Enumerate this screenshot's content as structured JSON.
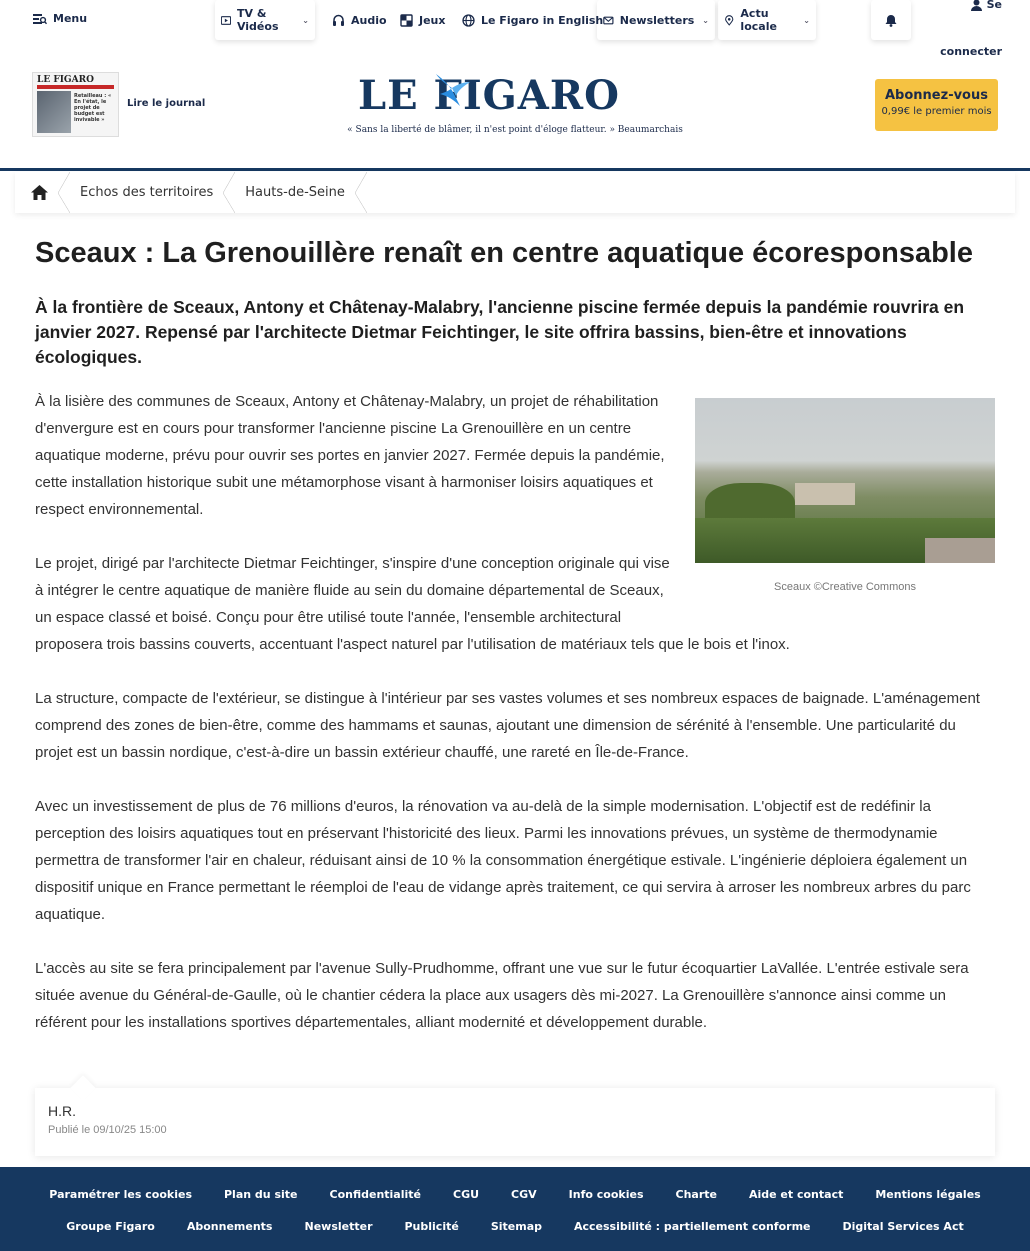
{
  "nav": {
    "menu": "Menu",
    "items": [
      {
        "label": "TV & Vidéos",
        "icon": "play-icon"
      },
      {
        "label": "Audio",
        "icon": "headphones-icon"
      },
      {
        "label": "Jeux",
        "icon": "puzzle-icon"
      },
      {
        "label": "Le Figaro in English",
        "icon": "globe-icon"
      },
      {
        "label": "Newsletters",
        "icon": "mail-icon"
      },
      {
        "label": "Actu locale",
        "icon": "location-icon"
      }
    ],
    "connect_line1": "Se",
    "connect_line2": "connecter"
  },
  "header": {
    "journal_title": "LE FIGARO",
    "journal_headline": "Retailleau : « En l'état, le projet de budget est invivable »",
    "lire": "Lire le journal",
    "logo": "LE FIGARO",
    "tagline": "« Sans la liberté de blâmer, il n'est point d'éloge flatteur. » Beaumarchais",
    "abo_title": "Abonnez-vous",
    "abo_price": "0,99€ le premier mois",
    "brand_color": "#163860",
    "accent_color": "#f5c242"
  },
  "breadcrumb": [
    "Echos des territoires",
    "Hauts-de-Seine"
  ],
  "article": {
    "title": "Sceaux : La Grenouillère renaît en centre aquatique écoresponsable",
    "chapo": "À la frontière de Sceaux, Antony et Châtenay-Malabry, l'ancienne piscine fermée depuis la pandémie rouvrira en janvier 2027. Repensé par l'architecte Dietmar Feichtinger, le site offrira bassins, bien-être et innovations écologiques.",
    "caption": "Sceaux ©Creative Commons",
    "paragraphs": [
      "À la lisière des communes de Sceaux, Antony et Châtenay-Malabry, un projet de réhabilitation d'envergure est en cours pour transformer l'ancienne piscine La Grenouillère en un centre aquatique moderne, prévu pour ouvrir ses portes en janvier 2027. Fermée depuis la pandémie, cette installation historique subit une métamorphose visant à harmoniser loisirs aquatiques et respect environnemental.",
      "Le projet, dirigé par l'architecte Dietmar Feichtinger, s'inspire d'une conception originale qui vise à intégrer le centre aquatique de manière fluide au sein du domaine départemental de Sceaux, un espace classé et boisé. Conçu pour être utilisé toute l'année, l'ensemble architectural proposera trois bassins couverts, accentuant l'aspect naturel par l'utilisation de matériaux tels que le bois et l'inox.",
      "La structure, compacte de l'extérieur, se distingue à l'intérieur par ses vastes volumes et ses nombreux espaces de baignade. L'aménagement comprend des zones de bien-être, comme des hammams et saunas, ajoutant une dimension de sérénité à l'ensemble. Une particularité du projet est un bassin nordique, c'est-à-dire un bassin extérieur chauffé, une rareté en Île-de-France.",
      "Avec un investissement de plus de 76 millions d'euros, la rénovation va au-delà de la simple modernisation. L'objectif est de redéfinir la perception des loisirs aquatiques tout en préservant l'historicité des lieux. Parmi les innovations prévues, un système de thermodynamie permettra de transformer l'air en chaleur, réduisant ainsi de 10 % la consommation énergétique estivale. L'ingénierie déploiera également un dispositif unique en France permettant le réemploi de l'eau de vidange après traitement, ce qui servira à arroser les nombreux arbres du parc aquatique.",
      "L'accès au site se fera principalement par l'avenue Sully-Prudhomme, offrant une vue sur le futur écoquartier LaVallée. L'entrée estivale sera située avenue du Général-de-Gaulle, où le chantier cédera la place aux usagers dès mi-2027. La Grenouillère s'annonce ainsi comme un référent pour les installations sportives départementales, alliant modernité et développement durable."
    ],
    "author": "H.R.",
    "published": "Publié le 09/10/25 15:00"
  },
  "footer": {
    "row1": [
      "Paramétrer les cookies",
      "Plan du site",
      "Confidentialité",
      "CGU",
      "CGV",
      "Info cookies",
      "Charte",
      "Aide et contact",
      "Mentions légales"
    ],
    "row2": [
      "Groupe Figaro",
      "Abonnements",
      "Newsletter",
      "Publicité",
      "Sitemap",
      "Accessibilité : partiellement conforme",
      "Digital Services Act"
    ]
  }
}
